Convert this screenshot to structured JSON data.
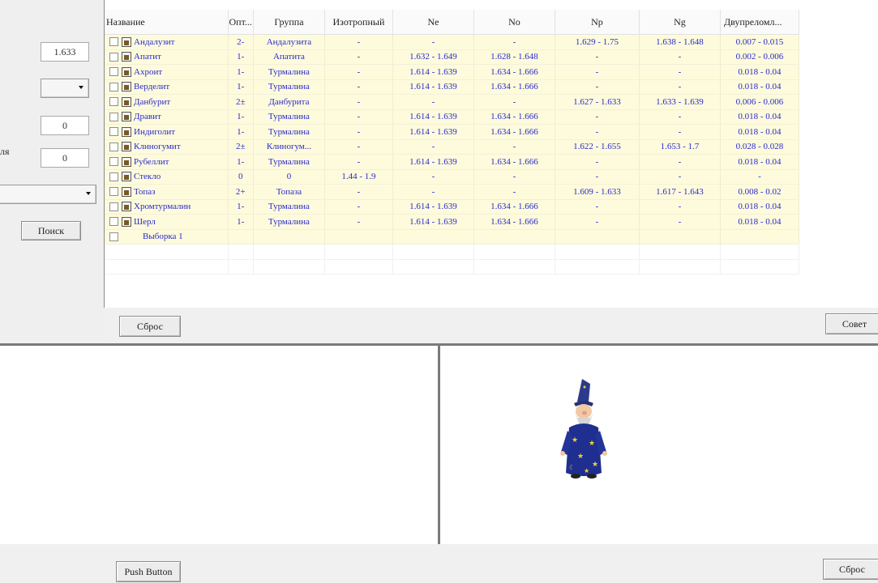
{
  "left": {
    "value1": "1.633",
    "value2": "0",
    "value3": "0",
    "side_label": "ля",
    "search_button": "Поиск"
  },
  "table": {
    "columns": [
      "Название",
      "Опт...",
      "Группа",
      "Изотропный",
      "Ne",
      "No",
      "Np",
      "Ng",
      "Двупреломл..."
    ],
    "rows": [
      {
        "name": "Андалузит",
        "opt": "2-",
        "group": "Андалузита",
        "iso": "-",
        "ne": "-",
        "no": "-",
        "np": "1.629 - 1.75",
        "ng": "1.638 - 1.648",
        "bir": "0.007 - 0.015"
      },
      {
        "name": "Апатит",
        "opt": "1-",
        "group": "Апатита",
        "iso": "-",
        "ne": "1.632 - 1.649",
        "no": "1.628 - 1.648",
        "np": "-",
        "ng": "-",
        "bir": "0.002 - 0.006"
      },
      {
        "name": "Ахроит",
        "opt": "1-",
        "group": "Турмалина",
        "iso": "-",
        "ne": "1.614 - 1.639",
        "no": "1.634 - 1.666",
        "np": "-",
        "ng": "-",
        "bir": "0.018 - 0.04"
      },
      {
        "name": "Верделит",
        "opt": "1-",
        "group": "Турмалина",
        "iso": "-",
        "ne": "1.614 - 1.639",
        "no": "1.634 - 1.666",
        "np": "-",
        "ng": "-",
        "bir": "0.018 - 0.04"
      },
      {
        "name": "Данбурит",
        "opt": "2±",
        "group": "Данбурита",
        "iso": "-",
        "ne": "-",
        "no": "-",
        "np": "1.627 - 1.633",
        "ng": "1.633 - 1.639",
        "bir": "0.006 - 0.006"
      },
      {
        "name": "Дравит",
        "opt": "1-",
        "group": "Турмалина",
        "iso": "-",
        "ne": "1.614 - 1.639",
        "no": "1.634 - 1.666",
        "np": "-",
        "ng": "-",
        "bir": "0.018 - 0.04"
      },
      {
        "name": "Индиголит",
        "opt": "1-",
        "group": "Турмалина",
        "iso": "-",
        "ne": "1.614 - 1.639",
        "no": "1.634 - 1.666",
        "np": "-",
        "ng": "-",
        "bir": "0.018 - 0.04"
      },
      {
        "name": "Клиногумит",
        "opt": "2±",
        "group": "Клиногум...",
        "iso": "-",
        "ne": "-",
        "no": "-",
        "np": "1.622 - 1.655",
        "ng": "1.653 - 1.7",
        "bir": "0.028 - 0.028"
      },
      {
        "name": "Рубеллит",
        "opt": "1-",
        "group": "Турмалина",
        "iso": "-",
        "ne": "1.614 - 1.639",
        "no": "1.634 - 1.666",
        "np": "-",
        "ng": "-",
        "bir": "0.018 - 0.04"
      },
      {
        "name": "Стекло",
        "opt": "0",
        "group": "0",
        "iso": "1.44 - 1.9",
        "ne": "-",
        "no": "-",
        "np": "-",
        "ng": "-",
        "bir": "-"
      },
      {
        "name": "Топаз",
        "opt": "2+",
        "group": "Топаза",
        "iso": "-",
        "ne": "-",
        "no": "-",
        "np": "1.609 - 1.633",
        "ng": "1.617 - 1.643",
        "bir": "0.008 - 0.02"
      },
      {
        "name": "Хромтурмалин",
        "opt": "1-",
        "group": "Турмалина",
        "iso": "-",
        "ne": "1.614 - 1.639",
        "no": "1.634 - 1.666",
        "np": "-",
        "ng": "-",
        "bir": "0.018 - 0.04"
      },
      {
        "name": "Шерл",
        "opt": "1-",
        "group": "Турмалина",
        "iso": "-",
        "ne": "1.614 - 1.639",
        "no": "1.634 - 1.666",
        "np": "-",
        "ng": "-",
        "bir": "0.018 - 0.04"
      }
    ],
    "selection_label": "Выборка 1"
  },
  "buttons": {
    "reset_top": "Сброс",
    "advice": "Совет",
    "push": "Push Button",
    "reset_bottom": "Сброс"
  },
  "colors": {
    "row_bg": "#fdfbdc",
    "cell_text": "#2a2acd"
  },
  "icons": [
    "document-icon",
    "checkbox",
    "dropdown-arrow",
    "wizard-assistant"
  ]
}
